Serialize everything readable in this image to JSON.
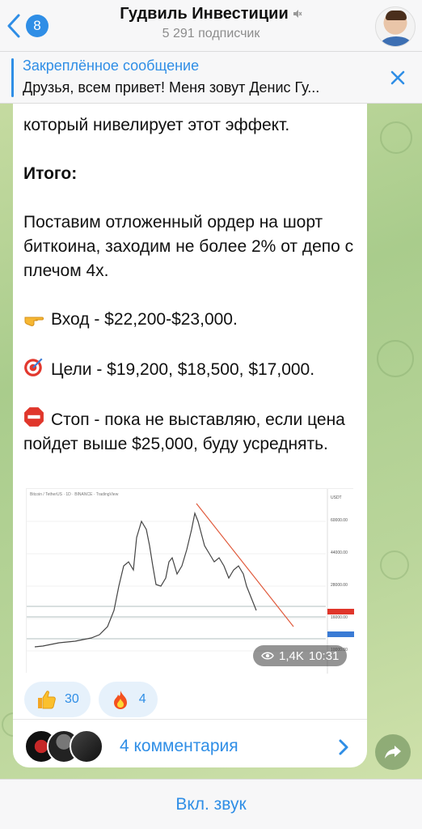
{
  "header": {
    "back_badge": "8",
    "title": "Гудвиль Инвестиции",
    "subscribers": "5 291 подписчик"
  },
  "pinned": {
    "title": "Закреплённое сообщение",
    "text": "Друзья, всем привет!  Меня зовут Денис Гу..."
  },
  "message": {
    "line_1": "который нивелирует этот эффект.",
    "summary_heading": "Итого:",
    "paragraph_1": "Поставим отложенный ордер на шорт биткоина, заходим не более 2% от депо с плечом 4х.",
    "entry": "Вход - $22,200-$23,000.",
    "targets": "Цели - $19,200, $18,500, $17,000.",
    "stop": "Стоп - пока не выставляю, если цена пойдет выше $25,000, буду усреднять."
  },
  "media": {
    "views": "1,4K",
    "time": "10:31"
  },
  "reactions": [
    {
      "emoji": "thumbs-up",
      "count": "30"
    },
    {
      "emoji": "fire",
      "count": "4"
    }
  ],
  "comments": {
    "label": "4 комментария"
  },
  "bottom": {
    "sound_button": "Вкл. звук"
  },
  "colors": {
    "accent": "#2f8ee6",
    "bubble": "#ffffff",
    "wallpaper": "#b9d59a"
  }
}
